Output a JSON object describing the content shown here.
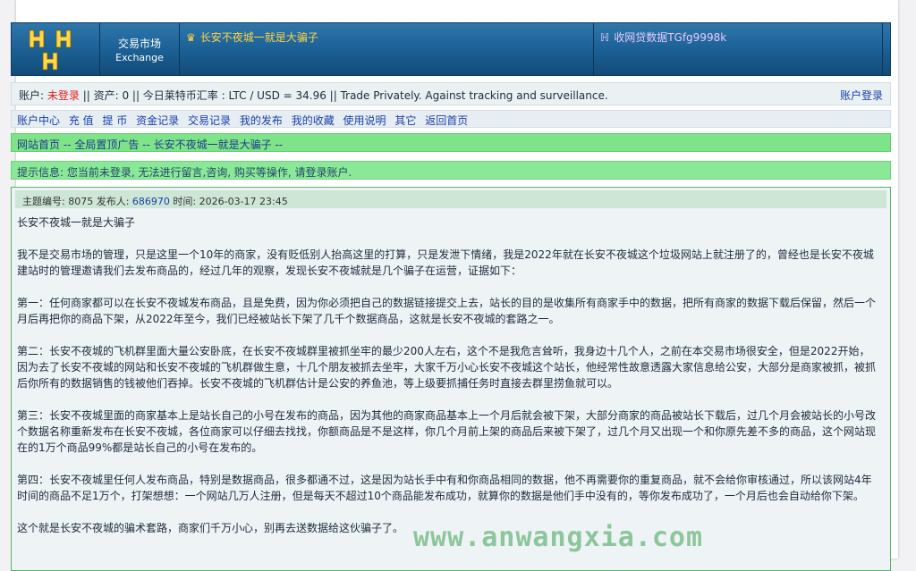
{
  "header": {
    "market_cn": "交易市场",
    "market_en": "Exchange",
    "ad_title": "长安不夜城一就是大骗子",
    "ad_glyph": "♛",
    "ad2_title": "收网贷数据TGfg9998k",
    "ad2_glyph": "ℍ"
  },
  "account": {
    "prefix": "账户: ",
    "status": "未登录",
    "rest": " || 资产: 0 || 今日莱特币汇率 : LTC / USD = 34.96 || Trade Privately. Against tracking and surveillance.",
    "login": "账户登录"
  },
  "menu": [
    "账户中心",
    "充 值",
    "提 币",
    "资金记录",
    "交易记录",
    "我的发布",
    "我的收藏",
    "使用说明",
    "其它",
    "返回首页"
  ],
  "breadcrumb": [
    "网站首页",
    " -- ",
    "全局置顶广告",
    " -- ",
    "长安不夜城一就是大骗子",
    " --"
  ],
  "notice": "提示信息: 您当前未登录, 无法进行留言,咨询, 购买等操作, 请登录账户.",
  "post": {
    "meta_prefix": "主题编号: 8075 发布人: ",
    "author": "686970",
    "meta_suffix": " 时间: 2026-03-17 23:45",
    "title": "长安不夜城一就是大骗子",
    "paragraphs": [
      "我不是交易市场的管理，只是这里一个10年的商家，没有贬低别人抬高这里的打算，只是发泄下情绪，我是2022年就在长安不夜城这个垃圾网站上就注册了的，曾经也是长安不夜城建站时的管理邀请我们去发布商品的，经过几年的观察，发现长安不夜城就是几个骗子在运营，证据如下：",
      "第一：任何商家都可以在长安不夜城发布商品，且是免费，因为你必须把自己的数据链接提交上去，站长的目的是收集所有商家手中的数据，把所有商家的数据下载后保留，然后一个月后再把你的商品下架，从2022年至今，我们已经被站长下架了几千个数据商品，这就是长安不夜城的套路之一。",
      "第二：长安不夜城的飞机群里面大量公安卧底，在长安不夜城群里被抓坐牢的最少200人左右，这个不是我危言耸听，我身边十几个人，之前在本交易市场很安全，但是2022开始，因为去了长安不夜城的网站和长安不夜城的飞机群做生意，十几个朋友被抓去坐牢，大家千万小心长安不夜城这个站长，他经常性故意透露大家信息给公安，大部分是商家被抓，被抓后你所有的数据销售的钱被他们吞掉。长安不夜城的飞机群估计是公安的养鱼池，等上级要抓捕任务时直接去群里捞鱼就可以。",
      "第三：长安不夜城里面的商家基本上是站长自己的小号在发布的商品，因为其他的商家商品基本上一个月后就会被下架，大部分商家的商品被站长下载后，过几个月会被站长的小号改个数据名称重新发布在长安不夜城，各位商家可以仔细去找找，你额商品是不是这样，你几个月前上架的商品后来被下架了，过几个月又出现一个和你原先差不多的商品，这个网站现在的1万个商品99%都是站长自己的小号在发布的。",
      "第四：长安不夜城里任何人发布商品，特别是数据商品，很多都通不过，这是因为站长手中有和你商品相同的数据，他不再需要你的重复商品，就不会给你审核通过，所以该网站4年时间的商品不足1万个，打架想想：一个网站几万人注册，但是每天不超过10个商品能发布成功，就算你的数据是他们手中没有的，等你发布成功了，一个月后也会自动给你下架。",
      "这个就是长安不夜城的骗术套路，商家们千万小心，别再去送数据给这伙骗子了。"
    ]
  },
  "watermark": "www.anwangxia.com",
  "colors": {
    "header_blue": "#1a5f93",
    "accent_green": "#7fe38a",
    "link_blue": "#1a3fa8",
    "alert_red": "#e02020"
  }
}
